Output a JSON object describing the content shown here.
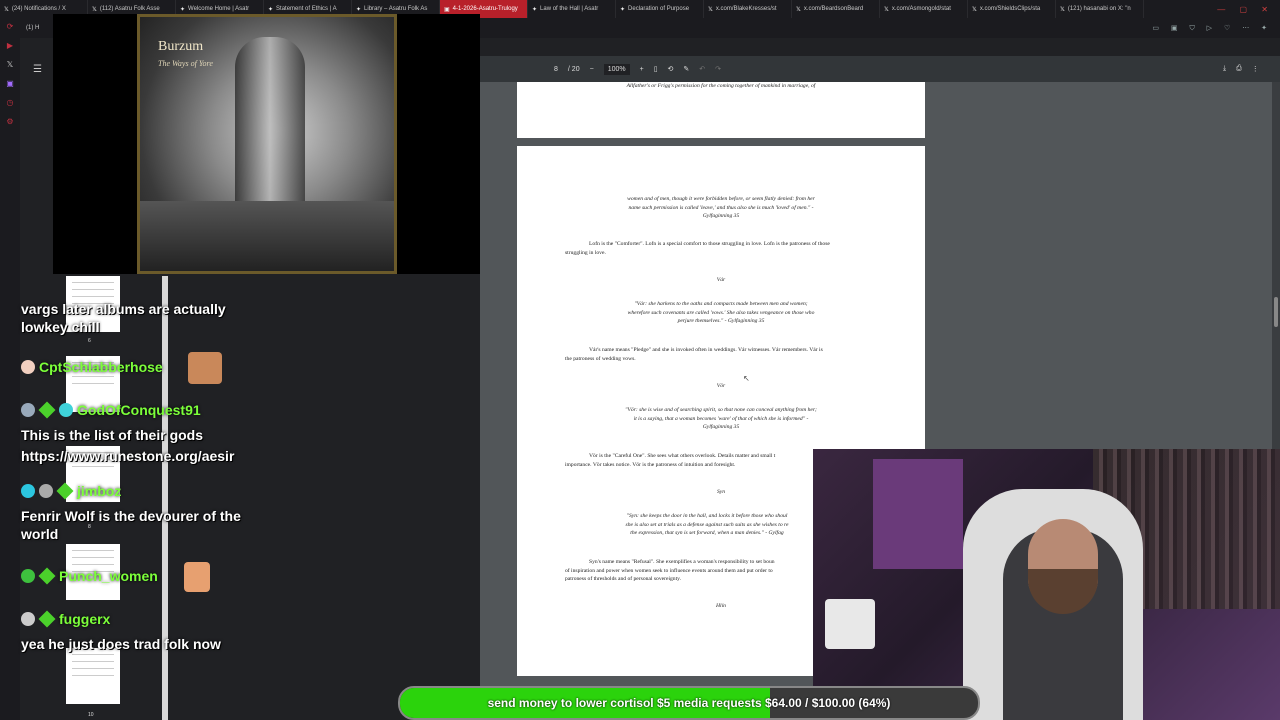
{
  "browser": {
    "tabs": [
      {
        "label": "(24) Notifications / X",
        "icon": "x-icon"
      },
      {
        "label": "(112) Asatru Folk Asse",
        "icon": "x-icon"
      },
      {
        "label": "Welcome Home | Asatr",
        "icon": "asatru-icon"
      },
      {
        "label": "Statement of Ethics | A",
        "icon": "asatru-icon"
      },
      {
        "label": "Library – Asatru Folk As",
        "icon": "asatru-icon"
      },
      {
        "label": "4-1-2026-Asatru-Trulogy",
        "icon": "pdf-icon",
        "active": true
      },
      {
        "label": "Law of the Hall | Asatr",
        "icon": "asatru-icon"
      },
      {
        "label": "Declaration of Purpose",
        "icon": "asatru-icon"
      },
      {
        "label": "x.com/BlakeKresses/st",
        "icon": "x-icon"
      },
      {
        "label": "x.com/BeardsonBeard",
        "icon": "x-icon"
      },
      {
        "label": "x.com/Asmongold/stat",
        "icon": "x-icon"
      },
      {
        "label": "x.com/ShieldsClips/sta",
        "icon": "x-icon"
      },
      {
        "label": "(121) hasanabi on X: \"n",
        "icon": "x-icon"
      }
    ],
    "side_tab": "(1) H"
  },
  "video": {
    "album_artist": "Burzum",
    "album_title": "The Ways of Yore"
  },
  "pdf": {
    "page_current": "8",
    "page_total": "/ 20",
    "zoom": "100%",
    "page1_tail": "Allfather's or Frigg's permission for the coming together of mankind in marriage, of",
    "quote_top_1": "women and of men, though it were forbidden before, or seem flatly denied: from her",
    "quote_top_2": "name such permission is called 'leave,' and thus also she is much 'loved' of men.\" -",
    "quote_top_3": "Gylfaginning 35",
    "lofn_1": "Lofn is the \"Comforter\". Lofn is a special comfort to those struggling in love. Lofn is the patroness of those",
    "lofn_2": "struggling in love.",
    "var_head": "Vár",
    "var_q1": "\"Vár: she harkens to the oaths and compacts made between men and women;",
    "var_q2": "wherefore such covenants are called 'vows.' She also takes vengeance on those who",
    "var_q3": "perjure themselves.\" - Gylfaginning 35",
    "var_p1": "Vár's name means \"Pledge\" and she is invoked often in weddings. Vár witnesses. Vár remembers. Vár is",
    "var_p2": "the patroness of wedding vows.",
    "vor_head": "Vör",
    "vor_q1": "\"Vör: she is wise and of searching spirit, so that none can conceal anything from her;",
    "vor_q2": "it is a saying, that a woman becomes 'ware' of that of which she is informed\" -",
    "vor_q3": "Gylfaginning 35",
    "vor_p1": "Vör is the \"Careful One\". She sees what others overlook. Details matter and small t",
    "vor_p2": "importance. Vör takes notice. Vör is the patroness of intuition and foresight.",
    "syn_head": "Syn",
    "syn_q1": "\"Syn: she keeps the door in the hall, and locks it before those who shoul",
    "syn_q2": "she is also set at trials as a defense against such suits as she wishes to re",
    "syn_q3": "the expression, that syn is set forward, when a man denies.\" - Gylfag",
    "syn_p1": "Syn's name means \"Refusal\". She exemplifies a woman's responsibility to set boun",
    "syn_p2": "of inspiration and power when women seek to influence events around them and put order to",
    "syn_p3": "patroness of thresholds and of personal sovereignty.",
    "hlin_head": "Hlín"
  },
  "thumbnails": {
    "numbers": [
      "6",
      "8",
      "10"
    ]
  },
  "chat": {
    "line_partial": "vargs later albums are actually lowkey chill",
    "user1": "CptSchlabberhose",
    "user2": "GodOfConquest91",
    "msg2a": "This is the list of their gods",
    "msg2b": "https://www.runestone.org/aesir",
    "user3": "jimboz",
    "msg3": "Fenrir Wolf is the devourer of the world",
    "user4": "Punch_women",
    "user5": "fuggerx",
    "msg5": "yea he just does trad folk now",
    "colors": {
      "username": "#7cff3a",
      "diamond": "#4bd12b"
    }
  },
  "goal": {
    "text": "send money to lower cortisol $5 media requests $64.00 / $100.00 (64%)",
    "progress": 0.64,
    "color": "#2bd30c"
  }
}
